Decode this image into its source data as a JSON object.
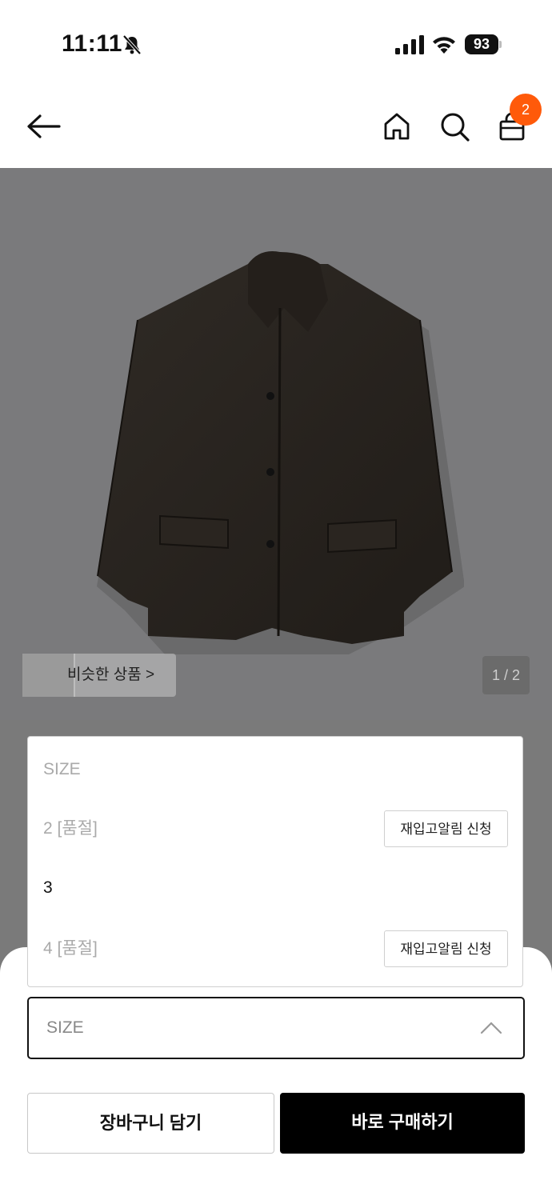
{
  "status_bar": {
    "time": "11:11",
    "battery": "93"
  },
  "header": {
    "cart_count": "2"
  },
  "hero": {
    "similar_label": "비슷한 상품 >",
    "pager": "1 / 2"
  },
  "size_list": {
    "header": "SIZE",
    "options": [
      {
        "label": "2 [품절]",
        "sold_out": true,
        "notify": "재입고알림 신청"
      },
      {
        "label": "3",
        "sold_out": false
      },
      {
        "label": "4 [품절]",
        "sold_out": true,
        "notify": "재입고알림 신청"
      }
    ]
  },
  "size_select": {
    "placeholder": "SIZE"
  },
  "actions": {
    "add_to_cart": "장바구니 담기",
    "buy_now": "바로 구매하기"
  },
  "colors": {
    "accent": "#ff5a0a",
    "buy_bg": "#000000",
    "dim": "#7a7a7a"
  }
}
